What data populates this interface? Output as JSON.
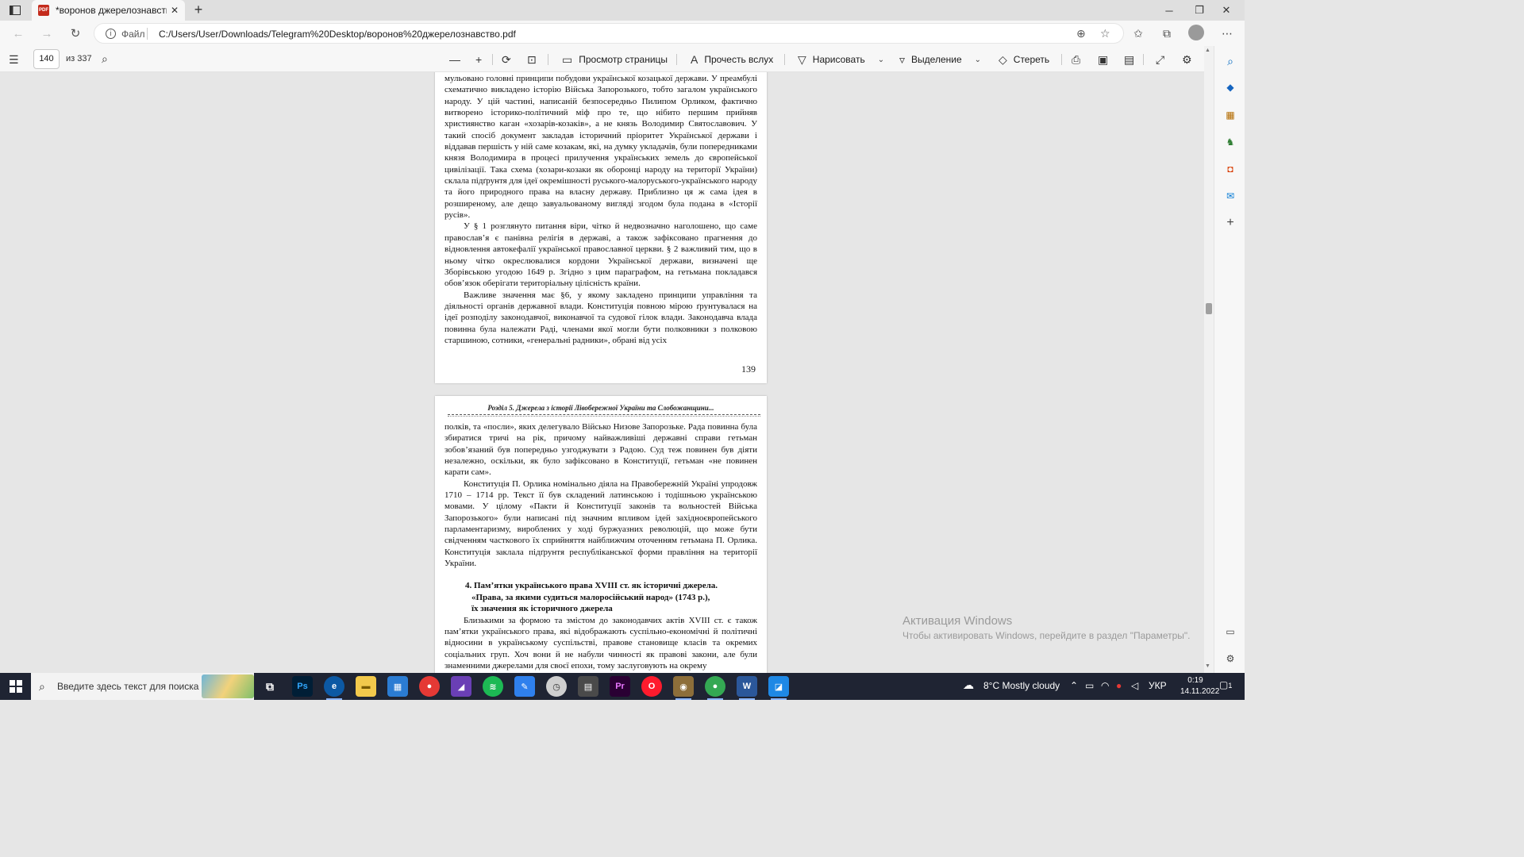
{
  "browser": {
    "tab_title": "*воронов джерелознавство.pdf",
    "scheme_label": "Файл",
    "url": "C:/Users/User/Downloads/Telegram%20Desktop/воронов%20джерелознавство.pdf"
  },
  "pdf_toolbar": {
    "page_current": "140",
    "page_total": "из 337",
    "page_view_label": "Просмотр страницы",
    "read_aloud_label": "Прочесть вслух",
    "draw_label": "Нарисовать",
    "highlight_label": "Выделение",
    "erase_label": "Стереть"
  },
  "page1": {
    "paragraphs": [
      "мульовано головні принципи побудови української козацької держави. У преамбулі схематично викладено історію Війська Запорозького, тобто загалом українського народу. У цій частині, написаній безпосередньо Пилипом Орликом, фактично витворено історико-політичний міф про те, що нібито першим прийняв християнство каган «хозарів-козаків», а не князь Володимир Святославович. У такий спосіб документ закладав історичний пріоритет Української держави і віддавав першість у ній саме козакам, які, на думку укладачів, були попередниками князя Володимира в процесі прилучення українських земель до європейської цивілізації. Така схема (хозари-козаки як оборонці народу на території України) склала підґрунтя для ідеї окремішності руського-малоруського-українського народу та його природного права на власну державу. Приблизно ця ж сама ідея в розширеному, але дещо завуальованому вигляді згодом була подана в «Історії русів».",
      "У § 1 розглянуто питання віри, чітко й недвозначно наголошено, що саме православ’я є панівна релігія в державі, а також зафіксовано прагнення до відновлення автокефалії української православної церкви. § 2 важливий тим, що в ньому чітко окреслювалися кордони Української держави, визначені ще Зборівською угодою 1649 р. Згідно з цим параграфом, на гетьмана покладався обов’язок оберігати територіальну цілісність країни.",
      "Важливе значення має §6, у якому закладено принципи управління та діяльності органів державної влади. Конституція повною мірою ґрунтувалася на ідеї розподілу законодавчої, виконавчої та судової гілок влади. Законодавча влада повинна була належати Раді, членами якої могли бути полковники з полковою старшиною, сотники, «генеральні радники», обрані від усіх"
    ],
    "page_number": "139"
  },
  "page2": {
    "running_head": "Розділ 5. Джерела з історії Лівобережної України та Слобожанщини...",
    "paragraphs": [
      "полків, та «посли», яких делегувало Військо Низове Запорозьке. Рада повинна була збиратися тричі на рік, причому найважливіші державні справи гетьман зобов’язаний був попередньо узгоджувати з Радою. Суд теж повинен був діяти незалежно, оскільки, як було зафіксовано в Конституції, гетьман «не повинен карати сам».",
      "Конституція П. Орлика номінально діяла на Правобережній Україні упродовж 1710 – 1714 рр. Текст її був складений латинською і тодішньою українською мовами. У цілому «Пакти й Конституції законів та вольностей Війська Запорозького» були написані під значним впливом ідей західноєвропейського парламентаризму, вироблених у ході буржуазних революцій, що може бути свідченням часткового їх сприйняття найближчим оточенням гетьмана П. Орлика. Конституція заклала підґрунтя республіканської форми правління на території України."
    ],
    "heading_line1": "4. Пам’ятки українського права XVIII ст. як історичні джерела.",
    "heading_line2": "«Права, за якими судиться малоросійський народ» (1743 р.),",
    "heading_line3": "їх значення як історичного джерела",
    "last_paragraph": "Близькими за формою та змістом до законодавчих актів XVIII ст. є також пам’ятки українського права, які відображають суспільно-економічні й політичні відносини в українському суспільстві, правове становище класів та окремих соціальних груп. Хоч вони й не набули чинності як правові закони, але були знаменними джерелами для своєї епохи, тому заслуговують на окрему"
  },
  "watermark": {
    "title": "Активация Windows",
    "subtitle": "Чтобы активировать Windows, перейдите в раздел \"Параметры\"."
  },
  "taskbar": {
    "search_placeholder": "Введите здесь текст для поиска",
    "weather": "8°C  Mostly cloudy",
    "language": "УКР",
    "time": "0:19",
    "date": "14.11.2022",
    "notification_count": "1"
  },
  "icons": {
    "pdf_tab_icon": "pdf-icon",
    "app_icons": [
      "task-view-icon",
      "photoshop-icon",
      "edge-icon",
      "file-explorer-icon",
      "store-icon",
      "chrome-icon",
      "app-icon",
      "spotify-icon",
      "notes-icon",
      "clock-app-icon",
      "calculator-icon",
      "premiere-icon",
      "opera-icon",
      "chrome-profile-icon",
      "chrome-icon-2",
      "word-icon",
      "paint-icon"
    ]
  },
  "colors": {
    "taskbar_bg": "#1f2433",
    "pdf_bg": "#e6e6e6",
    "tab_pdf_red": "#c42b1c"
  }
}
